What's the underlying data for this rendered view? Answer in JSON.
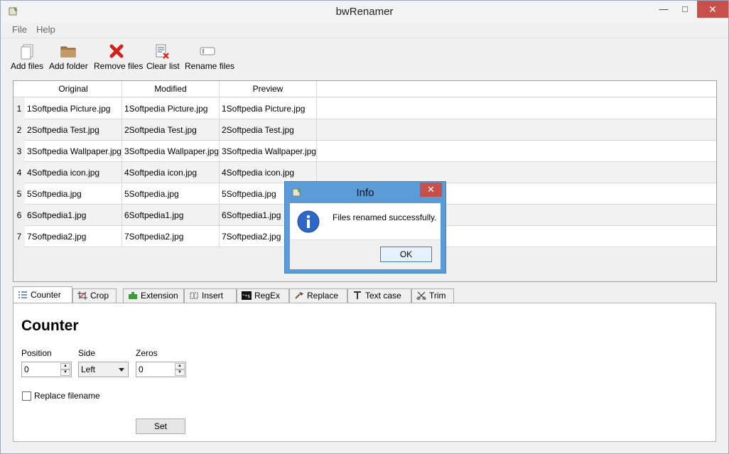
{
  "window": {
    "title": "bwRenamer"
  },
  "titlebar": {
    "minimize": "—",
    "maximize": "□",
    "close": "✕"
  },
  "menu": {
    "items": [
      "File",
      "Help"
    ]
  },
  "toolbar": {
    "items": [
      {
        "label": "Add files",
        "icon": "add-files-icon"
      },
      {
        "label": "Add folder",
        "icon": "folder-icon"
      },
      {
        "label": "Remove files",
        "icon": "red-x-icon"
      },
      {
        "label": "Clear list",
        "icon": "clear-list-icon"
      },
      {
        "label": "Rename files",
        "icon": "rename-icon"
      }
    ]
  },
  "table": {
    "columns": [
      "Original",
      "Modified",
      "Preview"
    ],
    "rows": [
      {
        "n": "1",
        "original": "1Softpedia Picture.jpg",
        "modified": "1Softpedia Picture.jpg",
        "preview": "1Softpedia Picture.jpg"
      },
      {
        "n": "2",
        "original": "2Softpedia Test.jpg",
        "modified": "2Softpedia Test.jpg",
        "preview": "2Softpedia Test.jpg"
      },
      {
        "n": "3",
        "original": "3Softpedia Wallpaper.jpg",
        "modified": "3Softpedia Wallpaper.jpg",
        "preview": "3Softpedia Wallpaper.jpg"
      },
      {
        "n": "4",
        "original": "4Softpedia icon.jpg",
        "modified": "4Softpedia icon.jpg",
        "preview": "4Softpedia icon.jpg"
      },
      {
        "n": "5",
        "original": "5Softpedia.jpg",
        "modified": "5Softpedia.jpg",
        "preview": "5Softpedia.jpg"
      },
      {
        "n": "6",
        "original": "6Softpedia1.jpg",
        "modified": "6Softpedia1.jpg",
        "preview": "6Softpedia1.jpg"
      },
      {
        "n": "7",
        "original": "7Softpedia2.jpg",
        "modified": "7Softpedia2.jpg",
        "preview": "7Softpedia2.jpg"
      }
    ]
  },
  "tabs": [
    {
      "label": "Counter",
      "icon": "counter-icon",
      "active": true
    },
    {
      "label": "Crop",
      "icon": "crop-icon"
    },
    {
      "label": "Extension",
      "icon": "extension-icon"
    },
    {
      "label": "Insert",
      "icon": "insert-icon"
    },
    {
      "label": "RegEx",
      "icon": "regex-icon"
    },
    {
      "label": "Replace",
      "icon": "replace-icon"
    },
    {
      "label": "Text case",
      "icon": "text-case-icon"
    },
    {
      "label": "Trim",
      "icon": "trim-icon"
    }
  ],
  "counter": {
    "heading": "Counter",
    "position_label": "Position",
    "position_value": "0",
    "side_label": "Side",
    "side_value": "Left",
    "zeros_label": "Zeros",
    "zeros_value": "0",
    "replace_filename_label": "Replace filename",
    "replace_filename_checked": false,
    "set_label": "Set"
  },
  "dialog": {
    "title": "Info",
    "close": "✕",
    "message": "Files renamed successfully.",
    "ok_label": "OK",
    "icon": "info-icon"
  },
  "colors": {
    "accent": "#5a9bd8",
    "close_red": "#c7504a"
  }
}
